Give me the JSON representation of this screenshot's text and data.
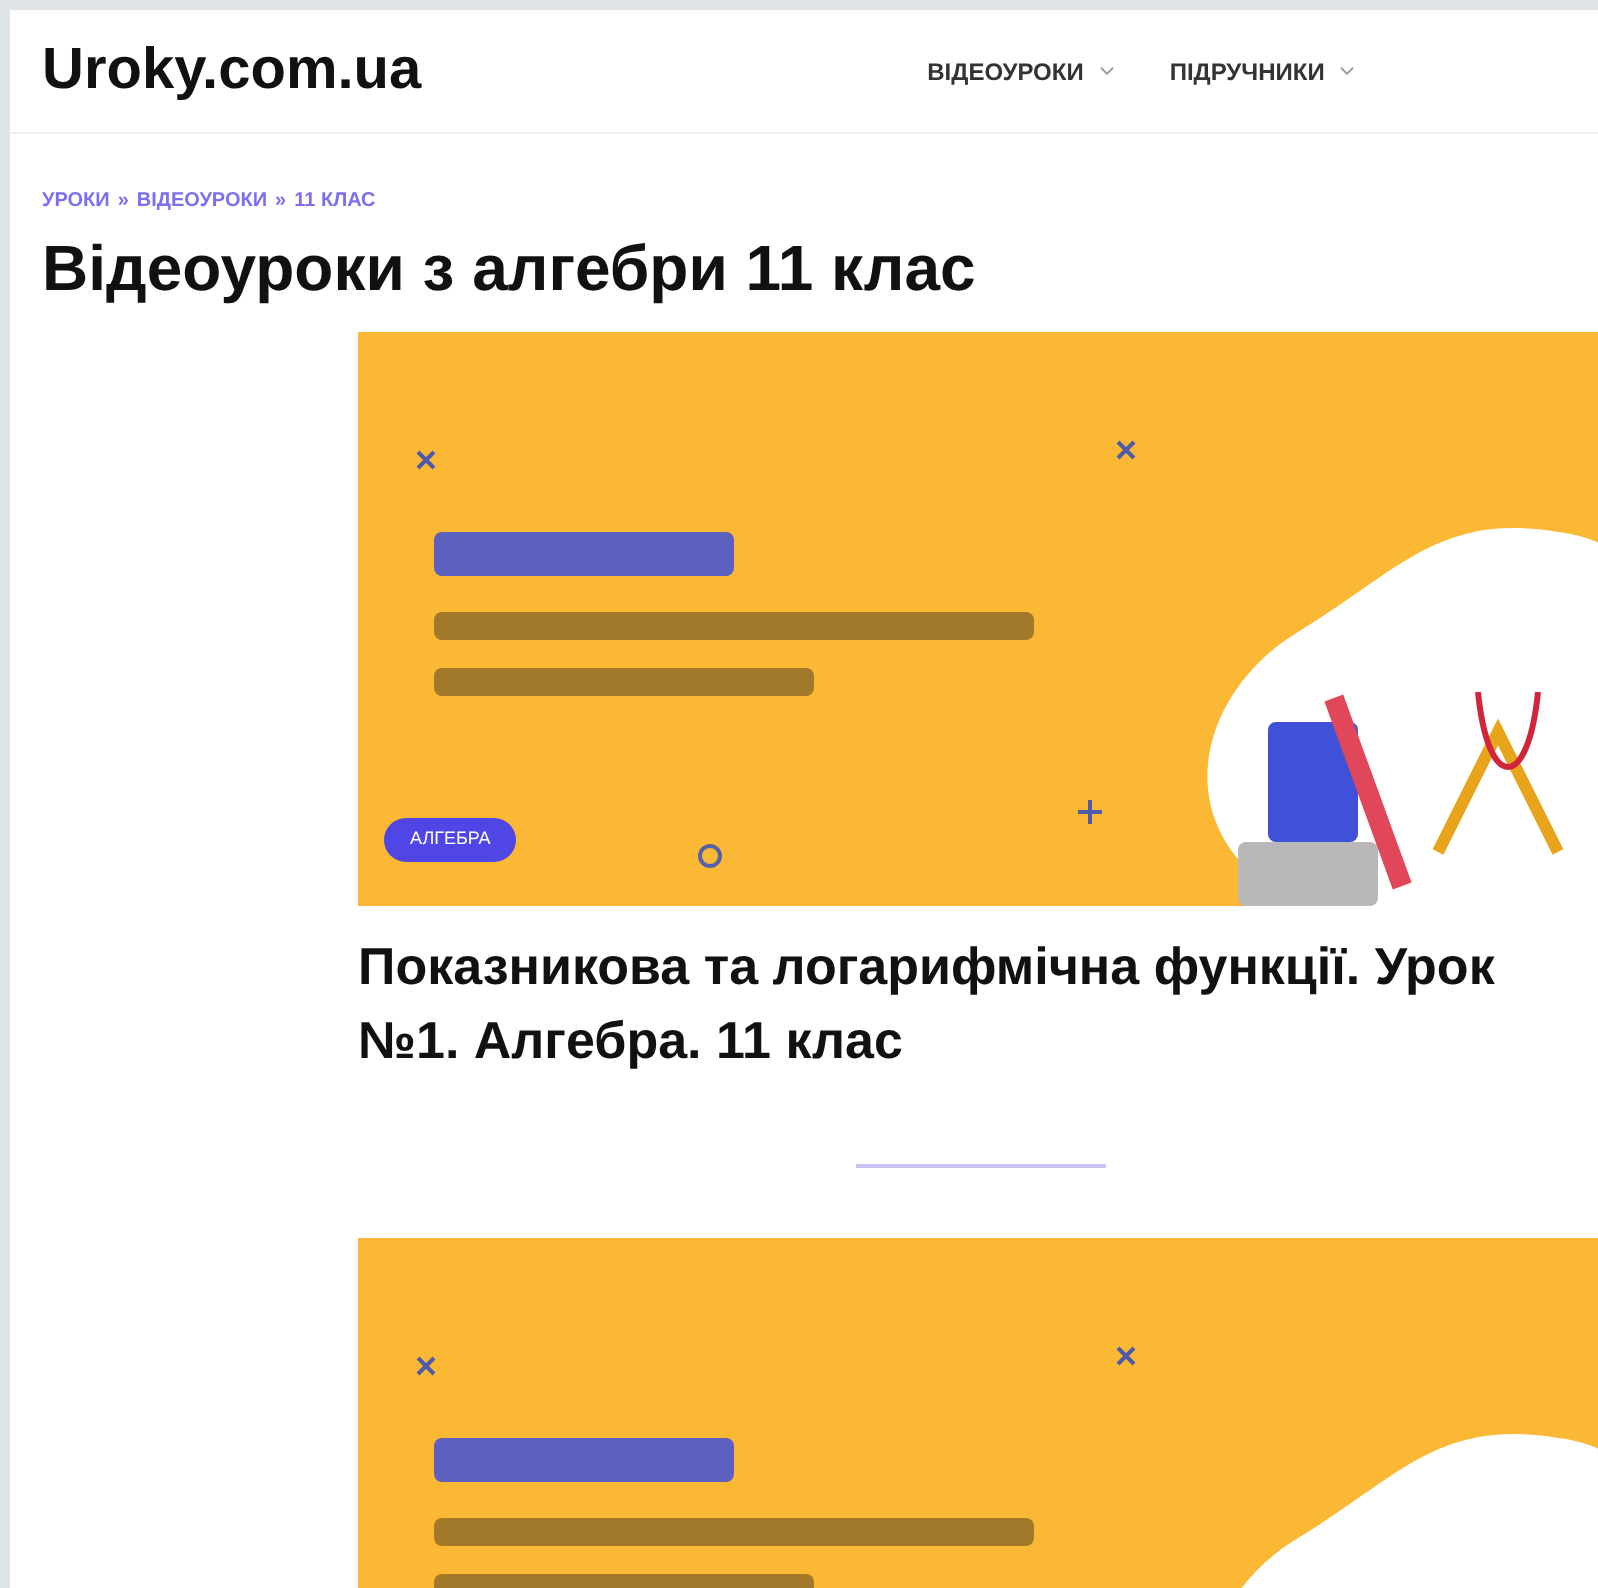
{
  "site": {
    "logo": "Uroky.com.ua"
  },
  "nav": [
    {
      "label": "ВІДЕОУРОКИ"
    },
    {
      "label": "ПІДРУЧНИКИ"
    }
  ],
  "breadcrumbs": {
    "separator": "»",
    "items": [
      "УРОКИ",
      "ВІДЕОУРОКИ",
      "11 КЛАС"
    ]
  },
  "page_title": "Відеоуроки з алгебри 11 клас",
  "posts": [
    {
      "kind": "picture",
      "badge": "АЛГЕБРА",
      "title": "Показникова та логарифмічна функції. Урок №1. Алгебра. 11 клас"
    },
    {
      "kind": "picture"
    }
  ]
}
